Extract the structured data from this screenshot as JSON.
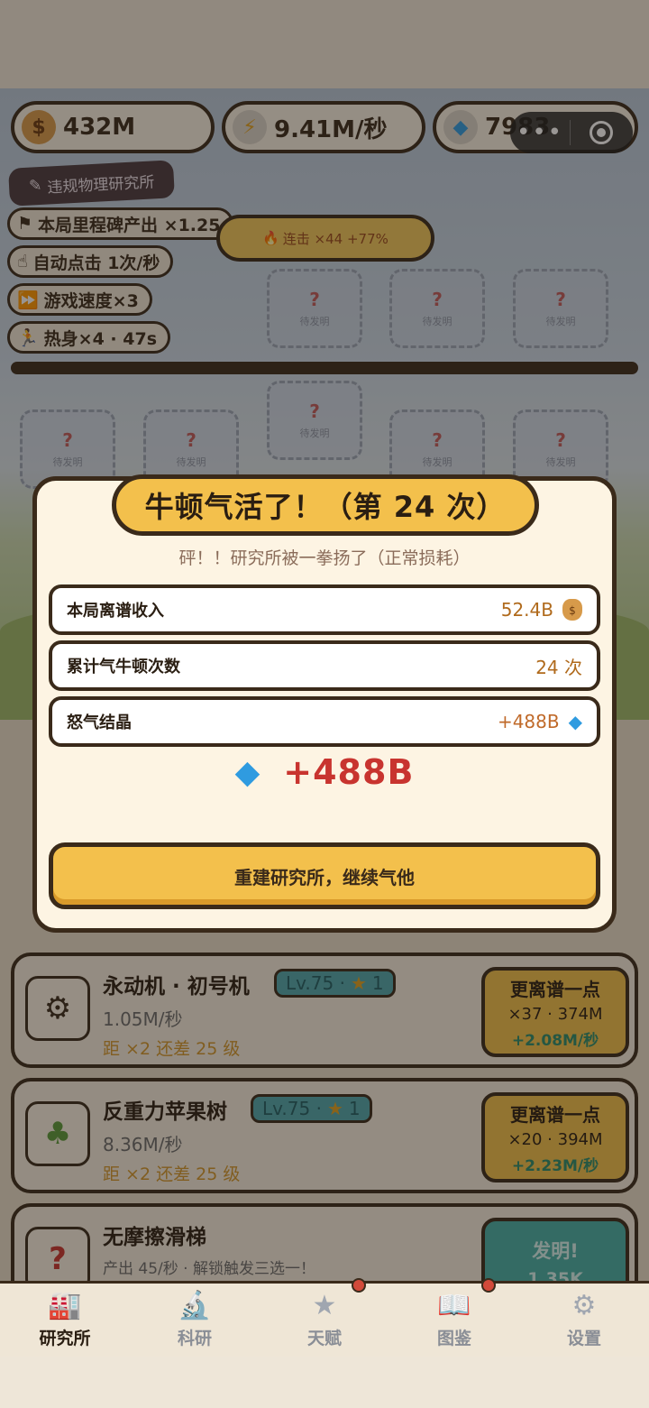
{
  "resources": {
    "coins": "432M",
    "speed": "9.41M/秒",
    "gems": "7983"
  },
  "lab": {
    "title": "违规物理研究所",
    "buffs": [
      "本局里程碑产出 ×1.25",
      "自动点击 1次/秒",
      "游戏速度×3",
      "热身×4 · 47s"
    ],
    "combo": "连击 ×44 +77%",
    "slot_label": "待发明",
    "slot_q": "?"
  },
  "modal": {
    "title": "牛顿气活了！（第 24 次）",
    "subtitle": "砰！！研究所被一拳扬了（正常损耗）",
    "stats": [
      {
        "label": "本局离谱收入",
        "value": "52.4B"
      },
      {
        "label": "累计气牛顿次数",
        "value": "24 次"
      },
      {
        "label": "怒气结晶",
        "value": "+488B"
      }
    ],
    "reward": "+488B",
    "button": "重建研究所，继续气他"
  },
  "inventions": [
    {
      "name": "永动机 · 初号机",
      "level": "Lv.75 · ",
      "stars": "1",
      "rate": "1.05M/秒",
      "next": "距 ×2 还差 25 级",
      "upgrade": {
        "title": "更离谱一点",
        "cost": "×37 · 374M",
        "gain": "+2.08M/秒"
      }
    },
    {
      "name": "反重力苹果树",
      "level": "Lv.75 · ",
      "stars": "1",
      "rate": "8.36M/秒",
      "next": "距 ×2 还差 25 级",
      "upgrade": {
        "title": "更离谱一点",
        "cost": "×20 · 394M",
        "gain": "+2.23M/秒"
      }
    },
    {
      "name": "无摩擦滑梯",
      "rate": "产出 45/秒 · 解锁触发三选一！",
      "invent": {
        "title": "发明!",
        "cost": "1.35K"
      }
    }
  ],
  "tabs": [
    {
      "label": "研究所",
      "icon": "factory-icon"
    },
    {
      "label": "科研",
      "icon": "microscope-icon"
    },
    {
      "label": "天赋",
      "icon": "star-icon"
    },
    {
      "label": "图鉴",
      "icon": "book-icon"
    },
    {
      "label": "设置",
      "icon": "gear-icon"
    }
  ],
  "colors": {
    "accent": "#f3c04c",
    "outline": "#3a2a1a",
    "gem": "#2f9be0",
    "reward_red": "#c8342f",
    "teal": "#45b0a6"
  }
}
